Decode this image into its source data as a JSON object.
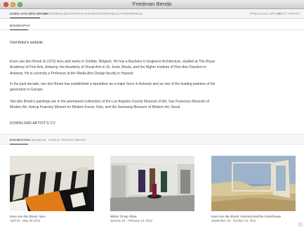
{
  "window": {
    "title": "Friedman Benda"
  },
  "topnav": {
    "items": [
      {
        "label": "Koen van den Broek",
        "active": true
      },
      {
        "label": "Artworks",
        "active": false
      },
      {
        "label": "Biography",
        "active": false
      },
      {
        "label": "Exhibitions",
        "active": false
      },
      {
        "label": "Publications",
        "active": false
      },
      {
        "label": "Press",
        "active": false
      }
    ],
    "previous_label": "Previous Artist",
    "next_label": "Next Artist"
  },
  "subnav": {
    "label": "Biography"
  },
  "bio": {
    "visit_link": "Visit Artist's website",
    "paragraphs": [
      "Koen van den Broek (b.1973) lives and works in Schilde, Belgium. He has a Bachelor in Engineer Architecture, studied at The Royal Academy of Fine Arts, Antwerp, the Academy of Visual Arts in St. Joost, Breda, and the Higher Institute of Fine Arts Flanders in Antwerp. He is currently a Professor at the Media Arts Design faculty in Hasselt.",
      "In the past decade, van den Broek has established a reputation as a major force in Antwerp and as one of the leading painters of his generation in Europe.",
      "Van den Broek's paintings are in the permanent collections of the Los Angeles County Museum of Art, San Francisco Museum of Modern Art, Astrup Fearnley Museet for Modern Kunst, Oslo, and the Samsung Museum of Modern Art, Seoul."
    ],
    "download_label": "Download Artist's CV"
  },
  "exhibition_tabs": [
    {
      "label": "Exhibitions",
      "active": true
    },
    {
      "label": "Museum",
      "active": false
    },
    {
      "label": "Public Projects",
      "active": false
    },
    {
      "label": "Fairs",
      "active": false
    }
  ],
  "exhibitions": [
    {
      "title": "Koen van den Broek, Apex",
      "dates": "April 25 - May 26 2013"
    },
    {
      "title": "Winter Group Show",
      "dates": "January 19 - February 14, 2012"
    },
    {
      "title": "Koen van den Broek, Insomnia and the Greenhouse",
      "dates": "September 15 - October 22, 2011"
    }
  ]
}
